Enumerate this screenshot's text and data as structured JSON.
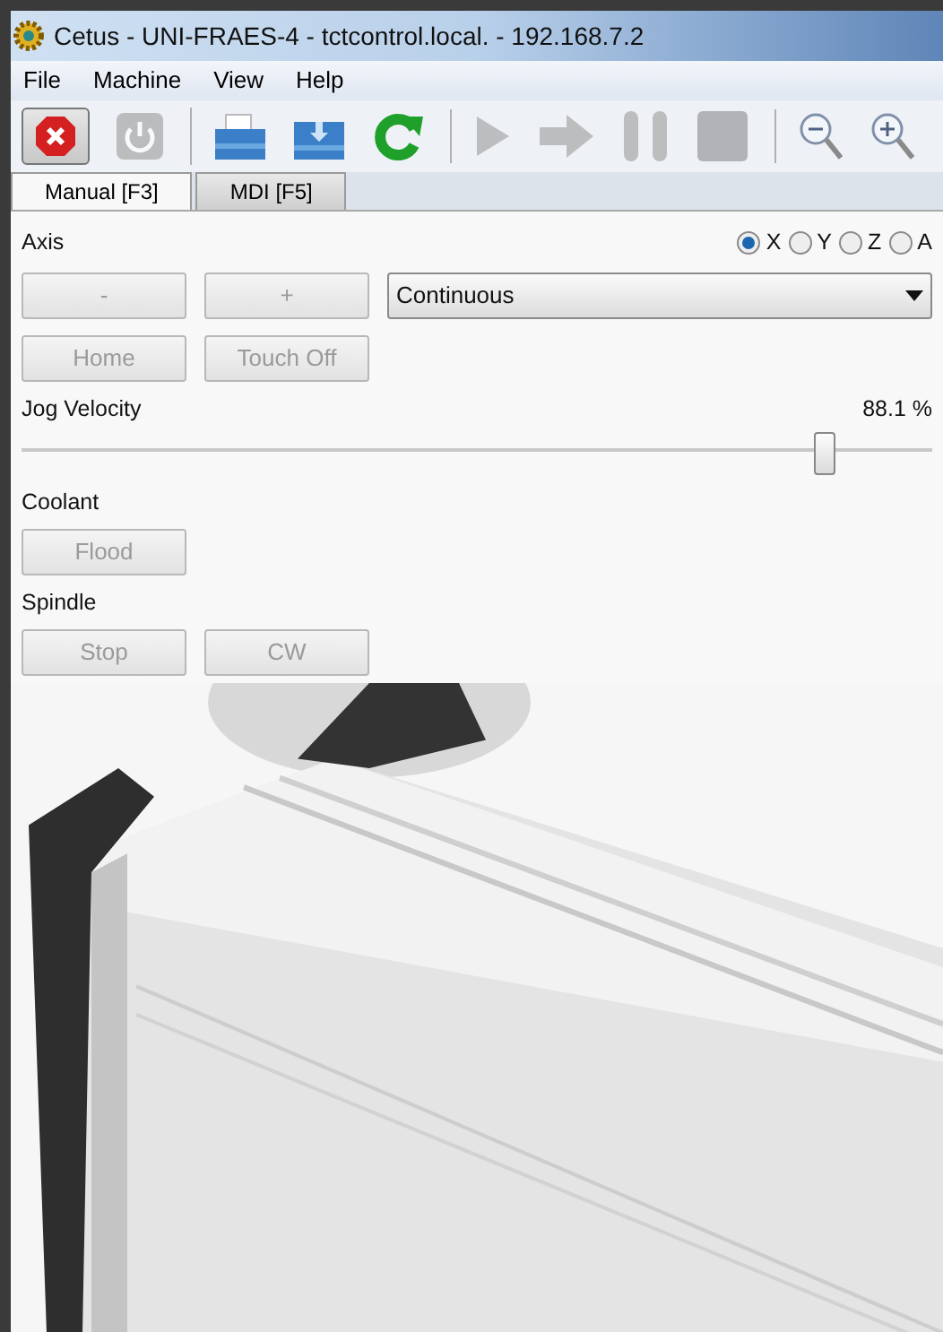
{
  "window": {
    "title": "Cetus - UNI-FRAES-4 - tctcontrol.local. - 192.168.7.2"
  },
  "menu": [
    "File",
    "Machine",
    "View",
    "Help"
  ],
  "toolbar": [
    {
      "kind": "estop",
      "disabled": false
    },
    {
      "kind": "power",
      "disabled": true
    },
    {
      "kind": "open",
      "disabled": false
    },
    {
      "kind": "reload-file",
      "disabled": false
    },
    {
      "kind": "refresh",
      "disabled": false
    },
    {
      "kind": "run",
      "disabled": true
    },
    {
      "kind": "step",
      "disabled": true
    },
    {
      "kind": "pause",
      "disabled": true
    },
    {
      "kind": "stop",
      "disabled": true
    },
    {
      "kind": "zoom-out",
      "disabled": false
    },
    {
      "kind": "zoom-in",
      "disabled": false
    }
  ],
  "tabs": [
    {
      "label": "Manual [F3]",
      "selected": true
    },
    {
      "label": "MDI [F5]",
      "selected": false
    }
  ],
  "axis": {
    "label": "Axis",
    "options": [
      {
        "label": "X",
        "selected": true
      },
      {
        "label": "Y",
        "selected": false
      },
      {
        "label": "Z",
        "selected": false
      },
      {
        "label": "A",
        "selected": false
      }
    ]
  },
  "jog_buttons": [
    {
      "label": "-",
      "disabled": true
    },
    {
      "label": "+",
      "disabled": true
    }
  ],
  "jog_mode": {
    "value": "Continuous"
  },
  "axis_buttons": [
    {
      "label": "Home",
      "disabled": true
    },
    {
      "label": "Touch Off",
      "disabled": true
    }
  ],
  "jog_velocity": {
    "label": "Jog Velocity",
    "reading": "88.1 %",
    "level": 0.881
  },
  "coolant": {
    "label": "Coolant",
    "buttons": [
      {
        "label": "Flood",
        "disabled": true
      }
    ]
  },
  "spindle": {
    "label": "Spindle",
    "buttons": [
      {
        "label": "Stop",
        "disabled": true
      },
      {
        "label": "CW",
        "disabled": true
      }
    ]
  }
}
